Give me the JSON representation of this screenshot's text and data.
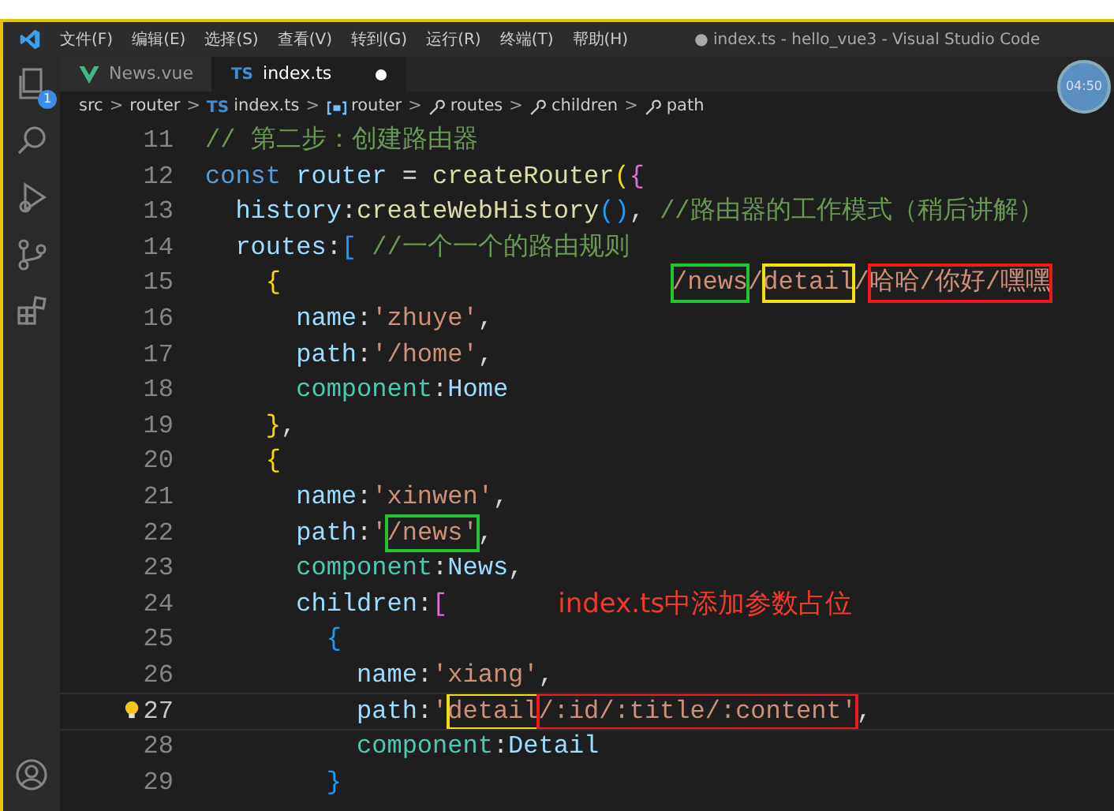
{
  "title_bar": {
    "menus": [
      "文件(F)",
      "编辑(E)",
      "选择(S)",
      "查看(V)",
      "转到(G)",
      "运行(R)",
      "终端(T)",
      "帮助(H)"
    ],
    "title": "● index.ts - hello_vue3 - Visual Studio Code"
  },
  "activity_bar": [
    {
      "kind": "explorer",
      "badge": "1"
    },
    {
      "kind": "search"
    },
    {
      "kind": "debug"
    },
    {
      "kind": "source-control"
    },
    {
      "kind": "extensions"
    }
  ],
  "account": {
    "kind": "account"
  },
  "tabs": [
    {
      "kind": "vue",
      "label": "News.vue",
      "selected": false,
      "modified": false
    },
    {
      "kind": "ts",
      "label": "index.ts",
      "selected": true,
      "modified": true,
      "badge": "TS"
    }
  ],
  "breadcrumbs": [
    {
      "kind": "folder",
      "label": "src"
    },
    {
      "kind": "folder",
      "separator": ">",
      "label": "router"
    },
    {
      "kind": "ts",
      "separator": ">",
      "badge": "TS",
      "label": "index.ts"
    },
    {
      "kind": "variable",
      "separator": ">",
      "label": "router"
    },
    {
      "kind": "property",
      "separator": ">",
      "label": "routes"
    },
    {
      "kind": "property",
      "separator": ">",
      "label": "children"
    },
    {
      "kind": "property",
      "separator": ">",
      "label": "path"
    }
  ],
  "clock": "04:50",
  "lines": [
    {
      "number": "11",
      "current": false,
      "tokens": [
        {
          "kind": "comment",
          "s": "// 第二步：创建路由器"
        }
      ]
    },
    {
      "number": "12",
      "current": false,
      "tokens": [
        {
          "kind": "keyword",
          "s": "const "
        },
        {
          "kind": "var",
          "s": "router"
        },
        {
          "kind": "plain",
          "s": " = "
        },
        {
          "kind": "func",
          "s": "createRouter"
        },
        {
          "kind": "brace1",
          "s": "("
        },
        {
          "kind": "brace2",
          "s": "{"
        }
      ]
    },
    {
      "number": "13",
      "current": false,
      "tokens": [
        {
          "kind": "var",
          "s": "  history"
        },
        {
          "kind": "plain",
          "s": ":"
        },
        {
          "kind": "func",
          "s": "createWebHistory"
        },
        {
          "kind": "brace3",
          "s": "()"
        },
        {
          "kind": "plain",
          "s": ", "
        },
        {
          "kind": "comment",
          "s": "//路由器的工作模式（稍后讲解）"
        }
      ]
    },
    {
      "number": "14",
      "current": false,
      "tokens": [
        {
          "kind": "var",
          "s": "  routes"
        },
        {
          "kind": "plain",
          "s": ":"
        },
        {
          "kind": "brace3",
          "s": "["
        },
        {
          "kind": "comment",
          "s": " //一个一个的路由规则"
        }
      ]
    },
    {
      "number": "15",
      "current": false,
      "tokens": [
        {
          "kind": "brace1",
          "s": "    {"
        }
      ],
      "callout": {
        "kind": "path",
        "segments": [
          {
            "s": "/news",
            "color": "#22c52e"
          },
          {
            "s": "/"
          },
          {
            "s": "detail",
            "color": "#f0e010"
          },
          {
            "s": "/"
          },
          {
            "s": "哈哈/你好/嘿嘿",
            "color": "#f01818"
          }
        ]
      }
    },
    {
      "number": "16",
      "current": false,
      "tokens": [
        {
          "kind": "var",
          "s": "      name"
        },
        {
          "kind": "plain",
          "s": ":"
        },
        {
          "kind": "string",
          "s": "'zhuye'"
        },
        {
          "kind": "plain",
          "s": ","
        }
      ]
    },
    {
      "number": "17",
      "current": false,
      "tokens": [
        {
          "kind": "var",
          "s": "      path"
        },
        {
          "kind": "plain",
          "s": ":"
        },
        {
          "kind": "string",
          "s": "'/home'"
        },
        {
          "kind": "plain",
          "s": ","
        }
      ]
    },
    {
      "number": "18",
      "current": false,
      "tokens": [
        {
          "kind": "prop",
          "s": "      component"
        },
        {
          "kind": "plain",
          "s": ":"
        },
        {
          "kind": "var",
          "s": "Home"
        }
      ]
    },
    {
      "number": "19",
      "current": false,
      "tokens": [
        {
          "kind": "brace1",
          "s": "    }"
        },
        {
          "kind": "plain",
          "s": ","
        }
      ]
    },
    {
      "number": "20",
      "current": false,
      "tokens": [
        {
          "kind": "brace1",
          "s": "    {"
        }
      ]
    },
    {
      "number": "21",
      "current": false,
      "tokens": [
        {
          "kind": "var",
          "s": "      name"
        },
        {
          "kind": "plain",
          "s": ":"
        },
        {
          "kind": "string",
          "s": "'xinwen'"
        },
        {
          "kind": "plain",
          "s": ","
        }
      ]
    },
    {
      "number": "22",
      "current": false,
      "tokens": [
        {
          "kind": "var",
          "s": "      path"
        },
        {
          "kind": "plain",
          "s": ":"
        },
        {
          "kind": "string",
          "s": "'"
        },
        {
          "kind": "string",
          "s": "/news'",
          "color": "#22c52e"
        },
        {
          "kind": "plain",
          "s": ","
        }
      ]
    },
    {
      "number": "23",
      "current": false,
      "tokens": [
        {
          "kind": "prop",
          "s": "      component"
        },
        {
          "kind": "plain",
          "s": ":"
        },
        {
          "kind": "var",
          "s": "News"
        },
        {
          "kind": "plain",
          "s": ","
        }
      ]
    },
    {
      "number": "24",
      "current": false,
      "tokens": [
        {
          "kind": "var",
          "s": "      children"
        },
        {
          "kind": "plain",
          "s": ":"
        },
        {
          "kind": "brace2",
          "s": "["
        }
      ],
      "callout": {
        "kind": "note",
        "text": "index.ts中添加参数占位",
        "color": "#f03a2a"
      }
    },
    {
      "number": "25",
      "current": false,
      "tokens": [
        {
          "kind": "brace3",
          "s": "        {"
        }
      ]
    },
    {
      "number": "26",
      "current": false,
      "tokens": [
        {
          "kind": "var",
          "s": "          name"
        },
        {
          "kind": "plain",
          "s": ":"
        },
        {
          "kind": "string",
          "s": "'xiang'"
        },
        {
          "kind": "plain",
          "s": ","
        }
      ]
    },
    {
      "number": "27",
      "current": true,
      "lightbulb": true,
      "tokens": [
        {
          "kind": "var",
          "s": "          path"
        },
        {
          "kind": "plain",
          "s": ":"
        },
        {
          "kind": "string",
          "s": "'"
        },
        {
          "kind": "string",
          "s": "detail",
          "color": "#f0e010"
        },
        {
          "kind": "string",
          "s": "/:id/:title/:content'",
          "color": "#f01818"
        },
        {
          "kind": "plain",
          "s": ","
        }
      ]
    },
    {
      "number": "28",
      "current": false,
      "tokens": [
        {
          "kind": "prop",
          "s": "          component"
        },
        {
          "kind": "plain",
          "s": ":"
        },
        {
          "kind": "var",
          "s": "Detail"
        }
      ]
    },
    {
      "number": "29",
      "current": false,
      "tokens": [
        {
          "kind": "brace3",
          "s": "        }"
        }
      ]
    }
  ]
}
